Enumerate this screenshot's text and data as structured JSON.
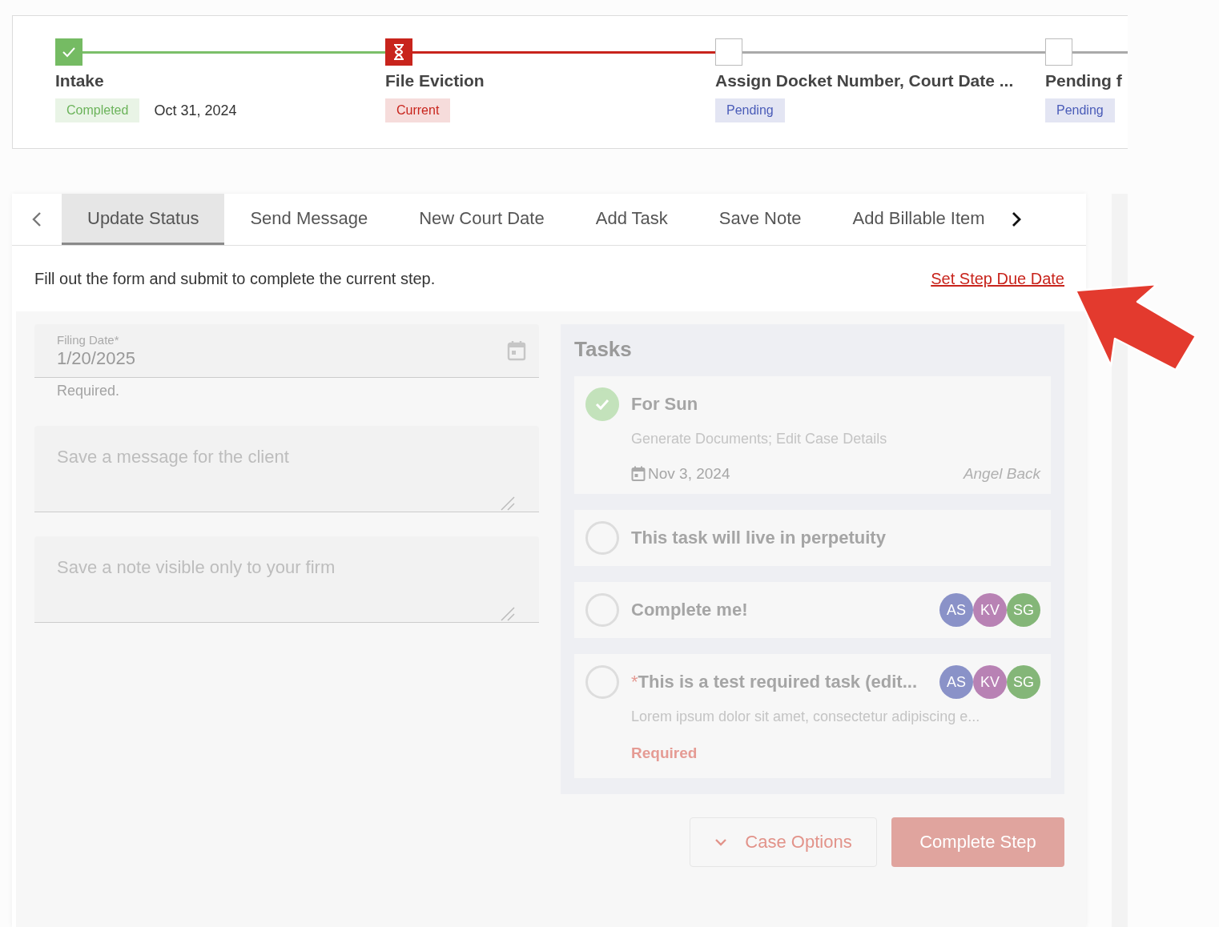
{
  "stepper": {
    "steps": [
      {
        "title": "Intake",
        "kind": "completed",
        "status": "Completed",
        "date": "Oct 31, 2024"
      },
      {
        "title": "File Eviction",
        "kind": "current",
        "status": "Current"
      },
      {
        "title": "Assign Docket Number, Court Date ...",
        "kind": "pending",
        "status": "Pending"
      },
      {
        "title": "Pending f",
        "kind": "pending",
        "status": "Pending"
      }
    ]
  },
  "tabs": [
    {
      "label": "Update Status",
      "selected": true
    },
    {
      "label": "Send Message",
      "selected": false
    },
    {
      "label": "New Court Date",
      "selected": false
    },
    {
      "label": "Add Task",
      "selected": false
    },
    {
      "label": "Save Note",
      "selected": false
    },
    {
      "label": "Add Billable Item",
      "selected": false
    }
  ],
  "instruction": "Fill out the form and submit to complete the current step.",
  "due_date_link": "Set Step Due Date",
  "form": {
    "filing_date": {
      "label": "Filing Date*",
      "value": "1/20/2025",
      "helper": "Required."
    },
    "message": {
      "placeholder": "Save a message for the client"
    },
    "note": {
      "placeholder": "Save a note visible only to your firm"
    }
  },
  "tasks": {
    "title": "Tasks",
    "items": [
      {
        "checked": true,
        "title": "For Sun",
        "description": "Generate Documents; Edit Case Details",
        "date": "Nov 3, 2024",
        "assignee": "Angel Back"
      },
      {
        "checked": false,
        "title": "This task will live in perpetuity"
      },
      {
        "checked": false,
        "title": "Complete me!",
        "avatars": [
          {
            "initials": "AS",
            "color": "#8a92c8"
          },
          {
            "initials": "KV",
            "color": "#b882b4"
          },
          {
            "initials": "SG",
            "color": "#84b678"
          }
        ]
      },
      {
        "checked": false,
        "marker": "*",
        "title": "This is a test required task (edit...",
        "avatars": [
          {
            "initials": "AS",
            "color": "#8a92c8"
          },
          {
            "initials": "KV",
            "color": "#b882b4"
          },
          {
            "initials": "SG",
            "color": "#84b678"
          }
        ],
        "description": "Lorem ipsum dolor sit amet, consectetur adipiscing e...",
        "status": "Required"
      }
    ]
  },
  "buttons": {
    "case_options": "Case Options",
    "complete_step": "Complete Step"
  }
}
